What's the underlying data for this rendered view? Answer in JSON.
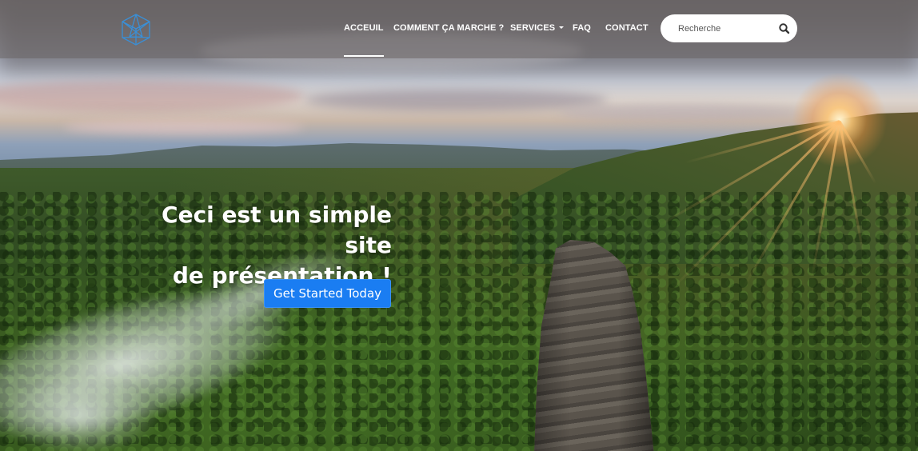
{
  "navbar": {
    "logo_icon": "cube-logo-icon",
    "items": [
      {
        "label": "ACCEUIL",
        "active": true
      },
      {
        "label": "COMMENT ÇA MARCHE ?",
        "active": false
      },
      {
        "label": "SERVICES",
        "active": false,
        "dropdown": true
      },
      {
        "label": "FAQ",
        "active": false
      },
      {
        "label": "CONTACT",
        "active": false
      }
    ],
    "search": {
      "placeholder": "Recherche",
      "value": "",
      "icon": "search-icon"
    }
  },
  "hero": {
    "headline_line1": "Ceci est un simple site",
    "headline_line2": "de présentation !",
    "cta_label": "Get Started Today"
  },
  "colors": {
    "accent": "#1a7df2",
    "nav_text": "#ffffff",
    "logo": "#3a8fd6"
  }
}
